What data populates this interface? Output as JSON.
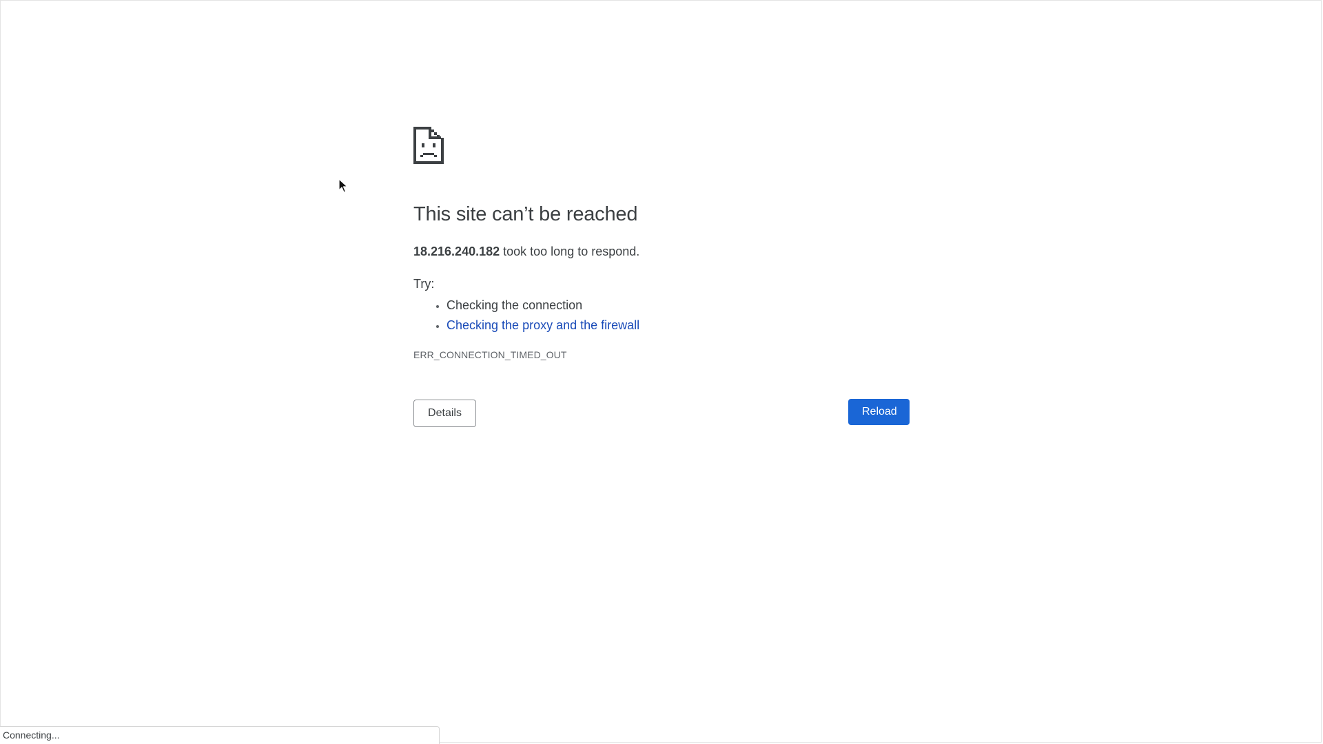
{
  "error": {
    "title": "This site can’t be reached",
    "host": "18.216.240.182",
    "summary_rest": " took too long to respond.",
    "try_label": "Try:",
    "suggestions": [
      {
        "text": "Checking the connection",
        "link": false
      },
      {
        "text": "Checking the proxy and the firewall",
        "link": true
      }
    ],
    "code": "ERR_CONNECTION_TIMED_OUT"
  },
  "buttons": {
    "details_label": "Details",
    "reload_label": "Reload"
  },
  "status_bar": {
    "text": "Connecting..."
  },
  "icons": {
    "error": "sad-document-icon",
    "cursor": "mouse-cursor-icon"
  },
  "colors": {
    "reload_bg": "#1a66d6",
    "link": "#1a4bb8",
    "text": "#3c4043"
  }
}
